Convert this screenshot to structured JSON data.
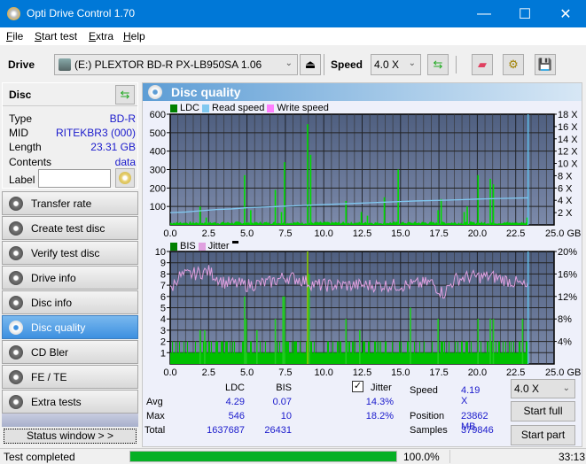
{
  "window": {
    "title": "Opti Drive Control 1.70",
    "minimize": "—",
    "maximize": "☐",
    "close": "✕"
  },
  "menu": [
    {
      "accel": "F",
      "rest": "ile"
    },
    {
      "accel": "S",
      "rest": "tart test"
    },
    {
      "accel": "E",
      "rest": "xtra"
    },
    {
      "accel": "H",
      "rest": "elp"
    }
  ],
  "toolbar": {
    "drive_label": "Drive",
    "drive_value": "(E:)  PLEXTOR BD-R  PX-LB950SA 1.06",
    "speed_label": "Speed",
    "speed_value": "4.0 X"
  },
  "disc": {
    "title": "Disc",
    "rows": [
      {
        "key": "Type",
        "value": "BD-R"
      },
      {
        "key": "MID",
        "value": "RITEKBR3 (000)"
      },
      {
        "key": "Length",
        "value": "23.31 GB"
      },
      {
        "key": "Contents",
        "value": "data"
      }
    ],
    "label_key": "Label",
    "label_value": ""
  },
  "nav": [
    {
      "label": "Transfer rate",
      "active": false
    },
    {
      "label": "Create test disc",
      "active": false
    },
    {
      "label": "Verify test disc",
      "active": false
    },
    {
      "label": "Drive info",
      "active": false
    },
    {
      "label": "Disc info",
      "active": false
    },
    {
      "label": "Disc quality",
      "active": true
    },
    {
      "label": "CD Bler",
      "active": false
    },
    {
      "label": "FE / TE",
      "active": false
    },
    {
      "label": "Extra tests",
      "active": false
    }
  ],
  "status_window_label": "Status window > >",
  "panel_title": "Disc quality",
  "chart_data": [
    {
      "type": "bar",
      "title": "LDC / Read speed",
      "legend": [
        "LDC",
        "Read speed",
        "Write speed"
      ],
      "colors": {
        "LDC": "#00cc00",
        "Read speed": "#80c8f0",
        "Write speed": "#ff80ff"
      },
      "xlabel": "GB",
      "xlim": [
        0,
        25
      ],
      "x_ticks": [
        "0.0",
        "2.5",
        "5.0",
        "7.5",
        "10.0",
        "12.5",
        "15.0",
        "17.5",
        "20.0",
        "22.5",
        "25.0 GB"
      ],
      "ylim": [
        0,
        600
      ],
      "y_ticks": [
        "100",
        "200",
        "300",
        "400",
        "500",
        "600"
      ],
      "y2lim": [
        0,
        18
      ],
      "y2_ticks": [
        "2 X",
        "4 X",
        "6 X",
        "8 X",
        "10 X",
        "12 X",
        "14 X",
        "16 X",
        "18 X"
      ],
      "end_position_gb": 23.31,
      "ldc_spikes": [
        [
          1.9,
          100
        ],
        [
          2.3,
          40
        ],
        [
          4.8,
          270
        ],
        [
          5.2,
          80
        ],
        [
          6.8,
          190
        ],
        [
          7.4,
          340
        ],
        [
          7.2,
          70
        ],
        [
          8.9,
          546
        ],
        [
          9.1,
          380
        ],
        [
          11.4,
          130
        ],
        [
          12.4,
          70
        ],
        [
          12.8,
          50
        ],
        [
          13.9,
          150
        ],
        [
          14.8,
          300
        ],
        [
          17.4,
          80
        ],
        [
          17.6,
          140
        ],
        [
          19.1,
          70
        ],
        [
          19.3,
          100
        ],
        [
          20.0,
          270
        ],
        [
          20.8,
          250
        ],
        [
          21.0,
          220
        ],
        [
          23.2,
          40
        ]
      ],
      "ldc_baseline": 12,
      "read_speed": [
        [
          0,
          2.0
        ],
        [
          1.0,
          2.1
        ],
        [
          2.0,
          2.3
        ],
        [
          3.0,
          2.5
        ],
        [
          4.0,
          2.6
        ],
        [
          5.0,
          2.8
        ],
        [
          6.0,
          2.9
        ],
        [
          7.0,
          3.0
        ],
        [
          8.0,
          3.1
        ],
        [
          9.0,
          3.2
        ],
        [
          10.0,
          3.3
        ],
        [
          11.0,
          3.4
        ],
        [
          12.0,
          3.5
        ],
        [
          13.0,
          3.6
        ],
        [
          14.0,
          3.7
        ],
        [
          15.0,
          3.8
        ],
        [
          16.0,
          3.9
        ],
        [
          17.5,
          4.0
        ],
        [
          19.0,
          4.1
        ],
        [
          20.0,
          4.2
        ],
        [
          21.5,
          4.3
        ],
        [
          23.3,
          4.4
        ]
      ]
    },
    {
      "type": "bar",
      "title": "BIS / Jitter",
      "legend": [
        "BIS",
        "Jitter"
      ],
      "colors": {
        "BIS": "#00cc00",
        "Jitter": "#e0a0e0"
      },
      "xlabel": "GB",
      "xlim": [
        0,
        25
      ],
      "x_ticks": [
        "0.0",
        "2.5",
        "5.0",
        "7.5",
        "10.0",
        "12.5",
        "15.0",
        "17.5",
        "20.0",
        "22.5",
        "25.0 GB"
      ],
      "ylim": [
        0,
        10
      ],
      "y_ticks": [
        "1",
        "2",
        "3",
        "4",
        "5",
        "6",
        "7",
        "8",
        "9",
        "10"
      ],
      "y2lim": [
        0,
        20
      ],
      "y2_ticks": [
        "4%",
        "8%",
        "12%",
        "16%",
        "20%"
      ],
      "end_position_gb": 23.31,
      "bis_spikes": [
        [
          1.9,
          3
        ],
        [
          2.2,
          3
        ],
        [
          4.8,
          6
        ],
        [
          4.9,
          4
        ],
        [
          5.6,
          3
        ],
        [
          6.8,
          4
        ],
        [
          7.3,
          6
        ],
        [
          7.4,
          6
        ],
        [
          8.9,
          10
        ],
        [
          9.0,
          8
        ],
        [
          11.4,
          4
        ],
        [
          12.3,
          3
        ],
        [
          15.6,
          5
        ],
        [
          17.4,
          4
        ],
        [
          20.0,
          4
        ],
        [
          20.8,
          4
        ],
        [
          21.0,
          4
        ],
        [
          22.9,
          4
        ]
      ],
      "jitter_profile_pct": [
        [
          0,
          13
        ],
        [
          0.5,
          15.5
        ],
        [
          1.5,
          16
        ],
        [
          2.5,
          16.5
        ],
        [
          3.5,
          14.5
        ],
        [
          5,
          14
        ],
        [
          6.5,
          14.5
        ],
        [
          7.5,
          15.5
        ],
        [
          8.5,
          15
        ],
        [
          9.5,
          14
        ],
        [
          11,
          14
        ],
        [
          12.5,
          14
        ],
        [
          14,
          14
        ],
        [
          15.5,
          14
        ],
        [
          17,
          14.5
        ],
        [
          17.8,
          12.5
        ],
        [
          18.5,
          15
        ],
        [
          19.5,
          15.5
        ],
        [
          21,
          15.5
        ],
        [
          22.5,
          14.5
        ],
        [
          23.3,
          13.5
        ]
      ]
    }
  ],
  "stats": {
    "col_ldc": "LDC",
    "col_bis": "BIS",
    "jitter_label": "Jitter",
    "jitter_checked": true,
    "rows": [
      {
        "label": "Avg",
        "ldc": "4.29",
        "bis": "0.07",
        "jitter": "14.3%"
      },
      {
        "label": "Max",
        "ldc": "546",
        "bis": "10",
        "jitter": "18.2%"
      },
      {
        "label": "Total",
        "ldc": "1637687",
        "bis": "26431",
        "jitter": ""
      }
    ],
    "speed_label": "Speed",
    "speed_value": "4.19 X",
    "position_label": "Position",
    "position_value": "23862 MB",
    "samples_label": "Samples",
    "samples_value": "379846",
    "speed_select": "4.0 X",
    "start_full": "Start full",
    "start_part": "Start part"
  },
  "statusbar": {
    "text": "Test completed",
    "progress": 100.0,
    "progress_text": "100.0%",
    "time": "33:13"
  }
}
